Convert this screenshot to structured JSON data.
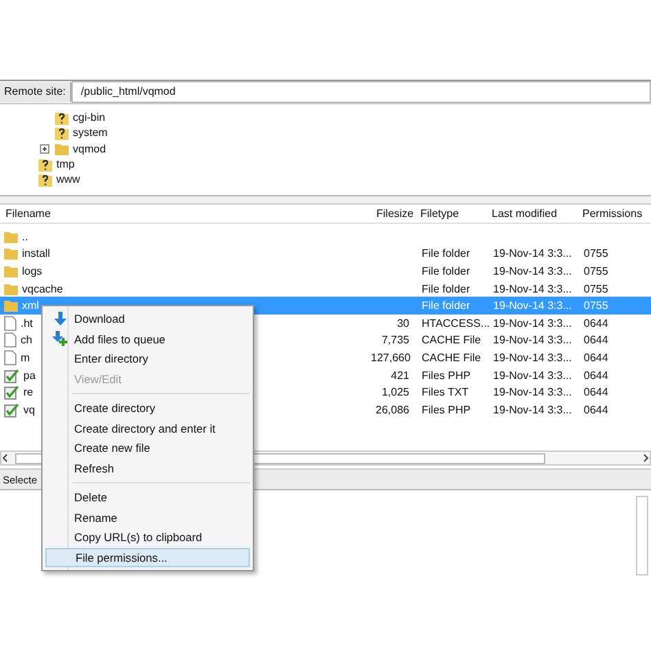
{
  "remote_site": {
    "label": "Remote site:",
    "path": "/public_html/vqmod"
  },
  "tree": {
    "inner": [
      {
        "label": "cgi-bin",
        "kind": "unknown"
      },
      {
        "label": "system",
        "kind": "unknown"
      },
      {
        "label": "vqmod",
        "kind": "folder",
        "expanded": false
      }
    ],
    "outer": [
      {
        "label": "tmp",
        "kind": "unknown"
      },
      {
        "label": "www",
        "kind": "unknown"
      }
    ]
  },
  "table": {
    "columns": [
      "Filename",
      "Filesize",
      "Filetype",
      "Last modified",
      "Permissions"
    ],
    "rows": [
      {
        "kind": "folder",
        "name": "..",
        "selected": false
      },
      {
        "kind": "folder",
        "name": "install",
        "type": "File folder",
        "modified": "19-Nov-14 3:3...",
        "perms": "0755",
        "selected": false
      },
      {
        "kind": "folder",
        "name": "logs",
        "type": "File folder",
        "modified": "19-Nov-14 3:3...",
        "perms": "0755",
        "selected": false
      },
      {
        "kind": "folder",
        "name": "vqcache",
        "type": "File folder",
        "modified": "19-Nov-14 3:3...",
        "perms": "0755",
        "selected": false
      },
      {
        "kind": "folder",
        "name": "xml",
        "type": "File folder",
        "modified": "19-Nov-14 3:3...",
        "perms": "0755",
        "selected": true
      },
      {
        "kind": "file",
        "name": ".ht",
        "size": "30",
        "type": "HTACCESS...",
        "modified": "19-Nov-14 3:3...",
        "perms": "0644",
        "selected": false
      },
      {
        "kind": "file",
        "name": "ch",
        "size": "7,735",
        "type": "CACHE File",
        "modified": "19-Nov-14 3:3...",
        "perms": "0644",
        "selected": false
      },
      {
        "kind": "file",
        "name": "m",
        "size": "127,660",
        "type": "CACHE File",
        "modified": "19-Nov-14 3:3...",
        "perms": "0644",
        "selected": false
      },
      {
        "kind": "script",
        "name": "pa",
        "size": "421",
        "type": "Files PHP",
        "modified": "19-Nov-14 3:3...",
        "perms": "0644",
        "selected": false
      },
      {
        "kind": "script",
        "name": "re",
        "size": "1,025",
        "type": "Files TXT",
        "modified": "19-Nov-14 3:3...",
        "perms": "0644",
        "selected": false
      },
      {
        "kind": "script",
        "name": "vq",
        "size": "26,086",
        "type": "Files PHP",
        "modified": "19-Nov-14 3:3...",
        "perms": "0644",
        "selected": false
      }
    ]
  },
  "status_bar": "Selecte",
  "context_menu": [
    {
      "kind": "download",
      "label": "Download",
      "disabled": false,
      "selected": false
    },
    {
      "kind": "queue",
      "label": "Add files to queue",
      "disabled": false,
      "selected": false
    },
    {
      "kind": "item",
      "label": "Enter directory",
      "disabled": false,
      "selected": false
    },
    {
      "kind": "item",
      "label": "View/Edit",
      "disabled": true,
      "selected": false
    },
    {
      "kind": "separator"
    },
    {
      "kind": "item",
      "label": "Create directory",
      "disabled": false,
      "selected": false
    },
    {
      "kind": "item",
      "label": "Create directory and enter it",
      "disabled": false,
      "selected": false
    },
    {
      "kind": "item",
      "label": "Create new file",
      "disabled": false,
      "selected": false
    },
    {
      "kind": "item",
      "label": "Refresh",
      "disabled": false,
      "selected": false
    },
    {
      "kind": "separator"
    },
    {
      "kind": "item",
      "label": "Delete",
      "disabled": false,
      "selected": false
    },
    {
      "kind": "item",
      "label": "Rename",
      "disabled": false,
      "selected": false
    },
    {
      "kind": "item",
      "label": "Copy URL(s) to clipboard",
      "disabled": false,
      "selected": false
    },
    {
      "kind": "item",
      "label": "File permissions...",
      "disabled": false,
      "selected": true
    }
  ]
}
